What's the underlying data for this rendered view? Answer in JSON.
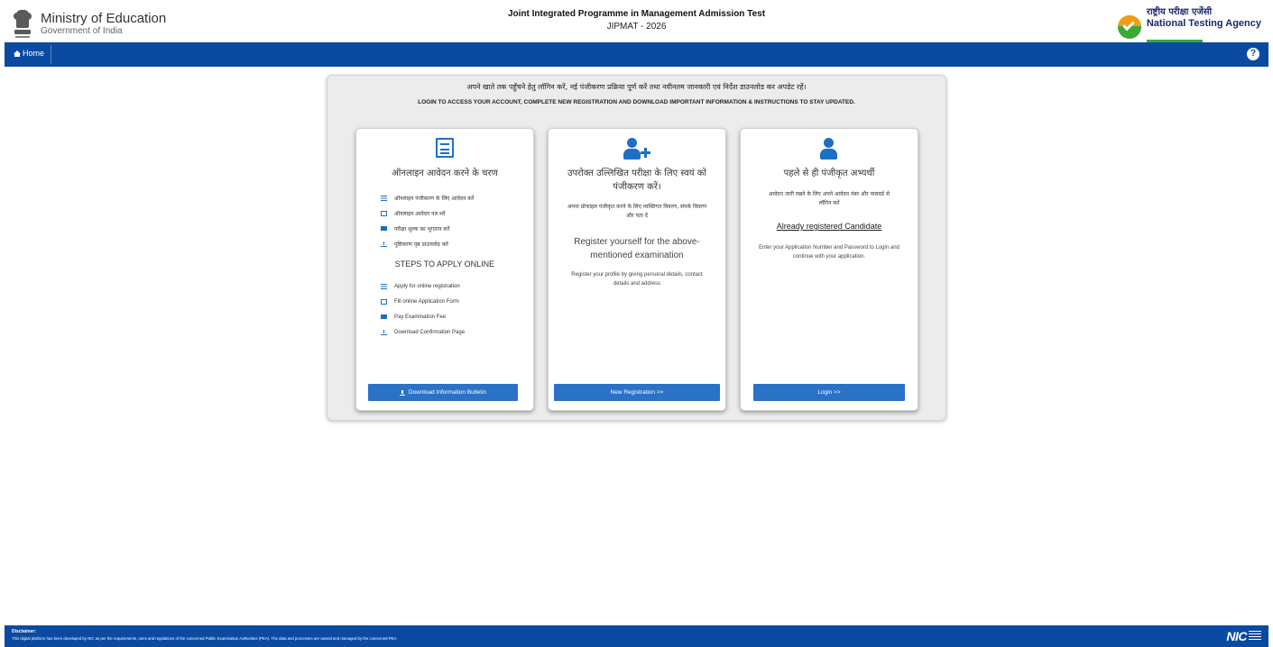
{
  "header": {
    "ministry_title": "Ministry of Education",
    "ministry_sub": "Government of India",
    "exam_full_name": "Joint Integrated Programme in Management Admission Test",
    "exam_short": "JIPMAT - 2026",
    "nta_hindi": "राष्ट्रीय परीक्षा एजेंसी",
    "nta_english": "National Testing Agency",
    "nta_tagline": "Excellence in Assessment"
  },
  "nav": {
    "home_label": "Home",
    "home_icon": "home-icon",
    "accessibility_icon": "accessibility-icon",
    "accessibility_glyph": "?",
    "color": "#0a4aa0"
  },
  "intro": {
    "hindi": "अपने खाते तक पहुँचने हेतु लॉगिन करें, नई पंजीकरण प्रक्रिया पूर्ण करें तथा नवीनतम जानकारी एवं निर्देश डाउनलोड कर अपडेट रहें।",
    "english": "LOGIN TO ACCESS YOUR ACCOUNT, COMPLETE NEW REGISTRATION AND DOWNLOAD IMPORTANT INFORMATION & INSTRUCTIONS TO STAY UPDATED."
  },
  "cards": [
    {
      "icon": "document-icon",
      "title_hi": "ऑनलाइन आवेदन करने के चरण",
      "steps_hi": [
        {
          "icon": "list-icon",
          "label": "ऑनलाइन पंजीकरण के लिए आवेदन करें"
        },
        {
          "icon": "file-icon",
          "label": "ऑनलाइन आवेदन पत्र भरें"
        },
        {
          "icon": "credit-card-icon",
          "label": "परीक्षा शुल्क का भुगतान करें"
        },
        {
          "icon": "download-icon",
          "label": "पुष्टिकरण पृष्ठ डाउनलोड करें"
        }
      ],
      "steps_title_en": "STEPS TO APPLY ONLINE",
      "steps_en": [
        {
          "icon": "list-icon",
          "label": "Apply for online registration"
        },
        {
          "icon": "file-icon",
          "label": "Fill online Application Form"
        },
        {
          "icon": "credit-card-icon",
          "label": "Pay Examination Fee"
        },
        {
          "icon": "download-icon",
          "label": "Download Confirmation Page"
        }
      ],
      "button_label": "Download Information Bulletin",
      "button_icon": "download-icon"
    },
    {
      "icon": "user-plus-icon",
      "title_hi": "उपरोक्त उल्लिखित परीक्षा के लिए स्वयं को पंजीकरण करें।",
      "sub_hi": "अपना प्रोफाइल पंजीकृत करने के लिए व्यक्तिगत विवरण, संपर्क विवरण और पता दें",
      "title_en": "Register yourself for the above-mentioned examination",
      "sub_en": "Register your profile by giving personal details, contact details and address",
      "button_label": "New Registration >>"
    },
    {
      "icon": "user-icon",
      "title_hi": "पहले से ही पंजीकृत अभ्यर्थी",
      "sub_hi": "आवेदन जारी रखने के लिए अपने आवेदन नंबर और पासवर्ड से लॉगिन करें",
      "link_label": "Already registered Candidate",
      "sub_en": "Enter your Application Number and Password to Login and continue with your application.",
      "button_label": "Login >>"
    }
  ],
  "footer": {
    "disclaimer_title": "Disclaimer:",
    "disclaimer_text": "This digital platform has been developed by NIC as per the requirements, rules and regulations of the concerned Public Examination Authorities (PEA). The data and processes are owned and managed by the concerned PEA.",
    "nic_logo": "NIC"
  }
}
